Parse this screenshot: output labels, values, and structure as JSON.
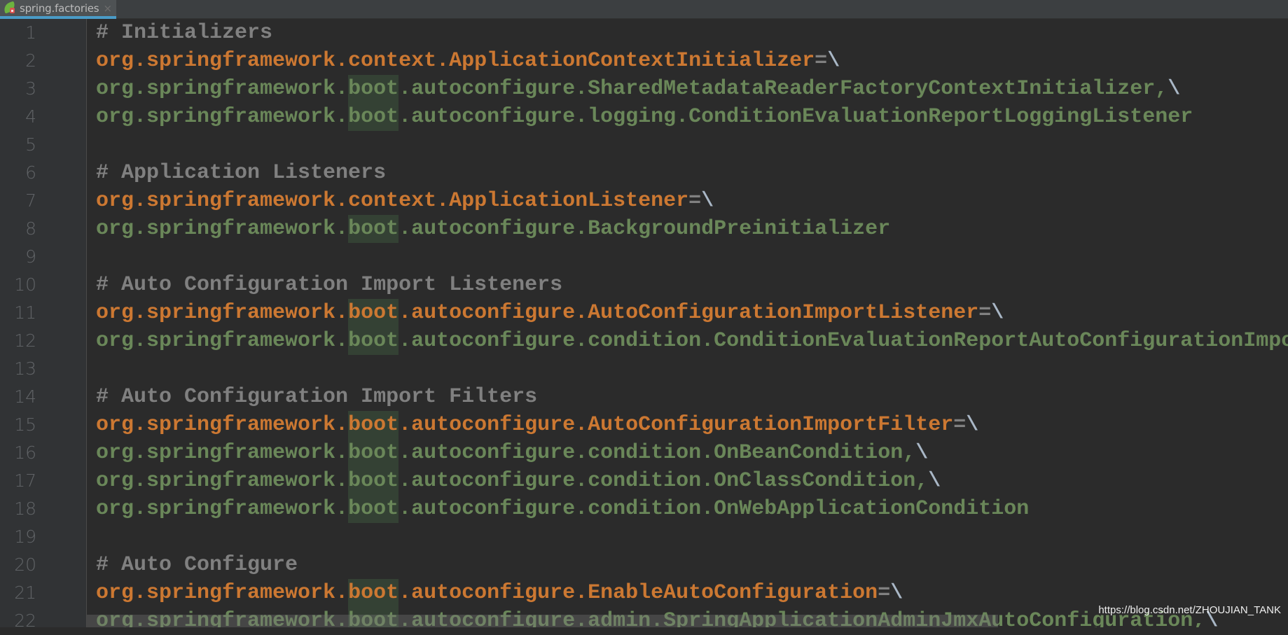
{
  "tab": {
    "icon": "spring-file-icon",
    "label": "spring.factories",
    "close_glyph": "×"
  },
  "colors": {
    "comment": "#808080",
    "key": "#CC7832",
    "value": "#6A8759",
    "backslash": "#A9B7C6",
    "highlight": "#344134",
    "background": "#2B2B2B",
    "gutter": "#313335",
    "tab_underline": "#4A9BC7"
  },
  "highlight_word": "boot",
  "lines": [
    {
      "n": "1",
      "type": "comment",
      "text": "# Initializers"
    },
    {
      "n": "2",
      "type": "key",
      "text": "org.springframework.context.ApplicationContextInitializer",
      "suffix": "=\\"
    },
    {
      "n": "3",
      "type": "value",
      "text": "org.springframework.boot.autoconfigure.SharedMetadataReaderFactoryContextInitializer,",
      "suffix": "\\"
    },
    {
      "n": "4",
      "type": "value",
      "text": "org.springframework.boot.autoconfigure.logging.ConditionEvaluationReportLoggingListener",
      "suffix": ""
    },
    {
      "n": "5",
      "type": "blank",
      "text": ""
    },
    {
      "n": "6",
      "type": "comment",
      "text": "# Application Listeners"
    },
    {
      "n": "7",
      "type": "key",
      "text": "org.springframework.context.ApplicationListener",
      "suffix": "=\\"
    },
    {
      "n": "8",
      "type": "value",
      "text": "org.springframework.boot.autoconfigure.BackgroundPreinitializer",
      "suffix": ""
    },
    {
      "n": "9",
      "type": "blank",
      "text": ""
    },
    {
      "n": "10",
      "type": "comment",
      "text": "# Auto Configuration Import Listeners"
    },
    {
      "n": "11",
      "type": "key",
      "text": "org.springframework.boot.autoconfigure.AutoConfigurationImportListener",
      "suffix": "=\\"
    },
    {
      "n": "12",
      "type": "value",
      "text": "org.springframework.boot.autoconfigure.condition.ConditionEvaluationReportAutoConfigurationImportListener",
      "suffix": ""
    },
    {
      "n": "13",
      "type": "blank",
      "text": ""
    },
    {
      "n": "14",
      "type": "comment",
      "text": "# Auto Configuration Import Filters"
    },
    {
      "n": "15",
      "type": "key",
      "text": "org.springframework.boot.autoconfigure.AutoConfigurationImportFilter",
      "suffix": "=\\"
    },
    {
      "n": "16",
      "type": "value",
      "text": "org.springframework.boot.autoconfigure.condition.OnBeanCondition,",
      "suffix": "\\"
    },
    {
      "n": "17",
      "type": "value",
      "text": "org.springframework.boot.autoconfigure.condition.OnClassCondition,",
      "suffix": "\\"
    },
    {
      "n": "18",
      "type": "value",
      "text": "org.springframework.boot.autoconfigure.condition.OnWebApplicationCondition",
      "suffix": ""
    },
    {
      "n": "19",
      "type": "blank",
      "text": ""
    },
    {
      "n": "20",
      "type": "comment",
      "text": "# Auto Configure"
    },
    {
      "n": "21",
      "type": "key",
      "text": "org.springframework.boot.autoconfigure.EnableAutoConfiguration",
      "suffix": "=\\"
    },
    {
      "n": "22",
      "type": "value",
      "text": "org.springframework.boot.autoconfigure.admin.SpringApplicationAdminJmxAutoConfiguration,",
      "suffix": "\\"
    }
  ],
  "watermark": "https://blog.csdn.net/ZHOUJIAN_TANK"
}
